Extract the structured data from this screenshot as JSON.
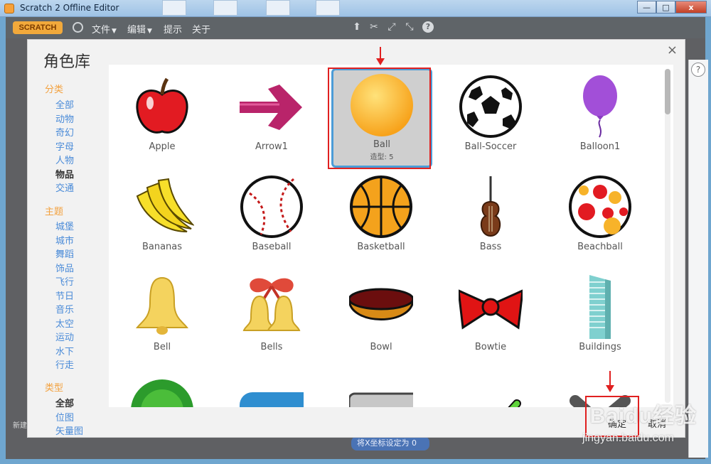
{
  "window": {
    "title": "Scratch 2 Offline Editor",
    "minimize": "—",
    "maximize": "□",
    "close": "x"
  },
  "menubar": {
    "logo": "SCRATCH",
    "items": [
      "文件",
      "编辑",
      "提示",
      "关于"
    ],
    "caret": "▼",
    "tools": [
      "stamp-icon",
      "cut-icon",
      "grow-icon",
      "shrink-icon",
      "help-icon"
    ],
    "help_glyph": "?"
  },
  "editor": {
    "new_sprite_label": "新建",
    "coord_button": "将X坐标设定为 0",
    "help_glyph": "?"
  },
  "dialog": {
    "title": "角色库",
    "close": "×",
    "category_heading": "分类",
    "categories": [
      "全部",
      "动物",
      "奇幻",
      "字母",
      "人物",
      "物品",
      "交通"
    ],
    "theme_heading": "主题",
    "themes": [
      "城堡",
      "城市",
      "舞蹈",
      "饰品",
      "飞行",
      "节日",
      "音乐",
      "太空",
      "运动",
      "水下",
      "行走"
    ],
    "type_heading": "类型",
    "types": [
      "全部",
      "位图",
      "矢量图"
    ],
    "active_category": "物品",
    "active_type": "全部",
    "ok_button": "确定",
    "cancel_button": "取消"
  },
  "sprites": [
    {
      "name": "Apple"
    },
    {
      "name": "Arrow1"
    },
    {
      "name": "Ball",
      "sub": "造型: 5",
      "selected": true
    },
    {
      "name": "Ball-Soccer"
    },
    {
      "name": "Balloon1"
    },
    {
      "name": "Bananas"
    },
    {
      "name": "Baseball"
    },
    {
      "name": "Basketball"
    },
    {
      "name": "Bass"
    },
    {
      "name": "Beachball"
    },
    {
      "name": "Bell"
    },
    {
      "name": "Bells"
    },
    {
      "name": "Bowl"
    },
    {
      "name": "Bowtie"
    },
    {
      "name": "Buildings"
    }
  ],
  "watermark": {
    "brand": "Baidu经验",
    "url": "jingyan.baidu.com"
  },
  "colors": {
    "accent_orange": "#f3a13e",
    "link_blue": "#4a8bd8",
    "selection_blue": "#4b9cd7",
    "annotation_red": "#e02020"
  }
}
